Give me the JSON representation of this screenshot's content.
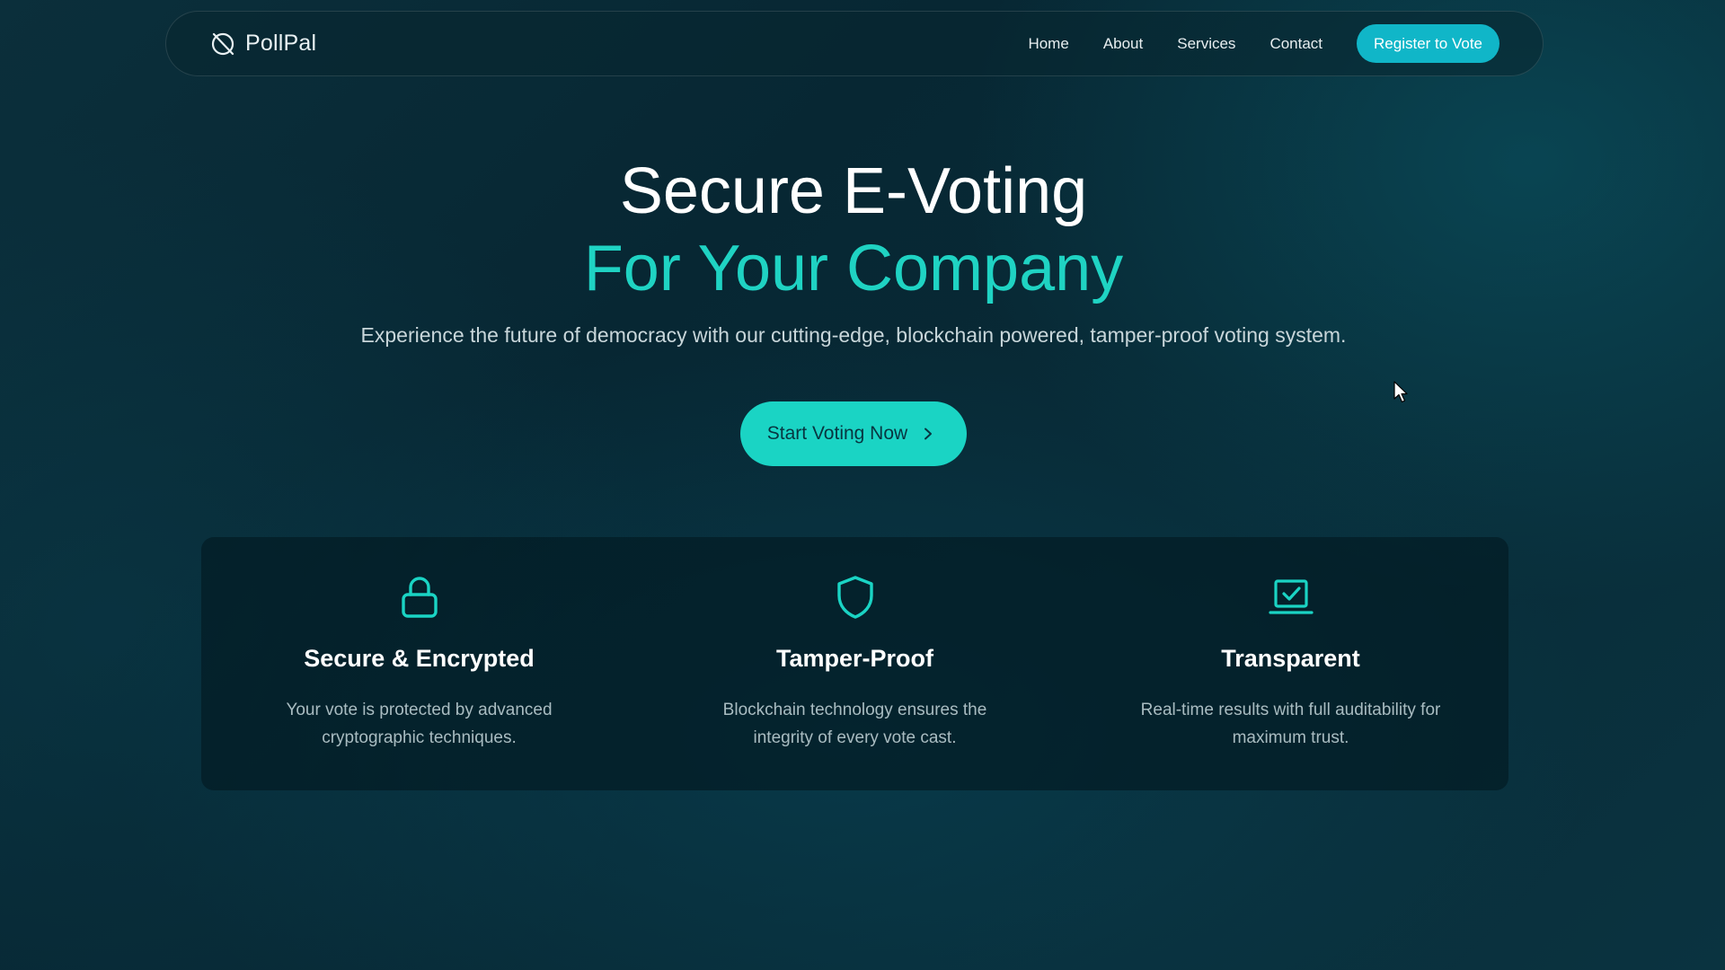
{
  "nav": {
    "brand": "PollPal",
    "links": [
      "Home",
      "About",
      "Services",
      "Contact"
    ],
    "register_label": "Register to Vote"
  },
  "hero": {
    "title_line1": "Secure E-Voting",
    "title_line2": "For Your Company",
    "subtitle": "Experience the future of democracy with our cutting-edge, blockchain powered, tamper-proof voting system.",
    "cta_label": "Start Voting Now"
  },
  "features": [
    {
      "icon": "lock-icon",
      "title": "Secure & Encrypted",
      "description": "Your vote is protected by advanced cryptographic techniques."
    },
    {
      "icon": "shield-icon",
      "title": "Tamper-Proof",
      "description": "Blockchain technology ensures the integrity of every vote cast."
    },
    {
      "icon": "laptop-check-icon",
      "title": "Transparent",
      "description": "Real-time results with full auditability for maximum trust."
    }
  ],
  "colors": {
    "accent": "#1ad4c4",
    "register_button": "#10b6c8",
    "background": "#072733"
  }
}
